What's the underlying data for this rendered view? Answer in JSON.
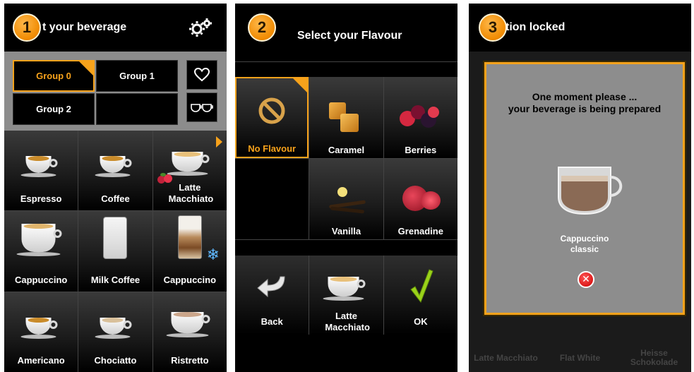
{
  "colors": {
    "accent": "#f7a21b",
    "panel_bg": "#000000",
    "modal_bg": "#8d8d8d"
  },
  "panel1": {
    "step": "1",
    "title": "t your beverage",
    "settings_icon": "gears-icon",
    "groups": [
      "Group 0",
      "Group 1",
      "Group 2",
      ""
    ],
    "active_group": "Group 0",
    "favorites_icon": "heart-icon",
    "cups_icon": "cups-icon",
    "beverages": [
      {
        "label": "Espresso"
      },
      {
        "label": "Coffee"
      },
      {
        "label": "Latte Macchiato"
      },
      {
        "label": "Cappuccino"
      },
      {
        "label": "Milk Coffee"
      },
      {
        "label": "Cappuccino"
      },
      {
        "label": "Americano"
      },
      {
        "label": "Chociatto"
      },
      {
        "label": "Ristretto"
      }
    ]
  },
  "panel2": {
    "step": "2",
    "title": "Select your Flavour",
    "flavours": [
      {
        "label": "No Flavour",
        "active": true
      },
      {
        "label": "Caramel"
      },
      {
        "label": "Berries"
      },
      {
        "label": ""
      },
      {
        "label": "Vanilla"
      },
      {
        "label": "Grenadine"
      }
    ],
    "back_label": "Back",
    "selected_beverage": "Latte Macchiato",
    "ok_label": "OK"
  },
  "panel3": {
    "step": "3",
    "title": "tion locked",
    "message_line1": "One moment please ...",
    "message_line2": "your beverage is being prepared",
    "beverage_line1": "Cappuccino",
    "beverage_line2": "classic",
    "background_labels": [
      "Latte Macchiato",
      "Flat White",
      "Heisse Schokolade"
    ]
  }
}
